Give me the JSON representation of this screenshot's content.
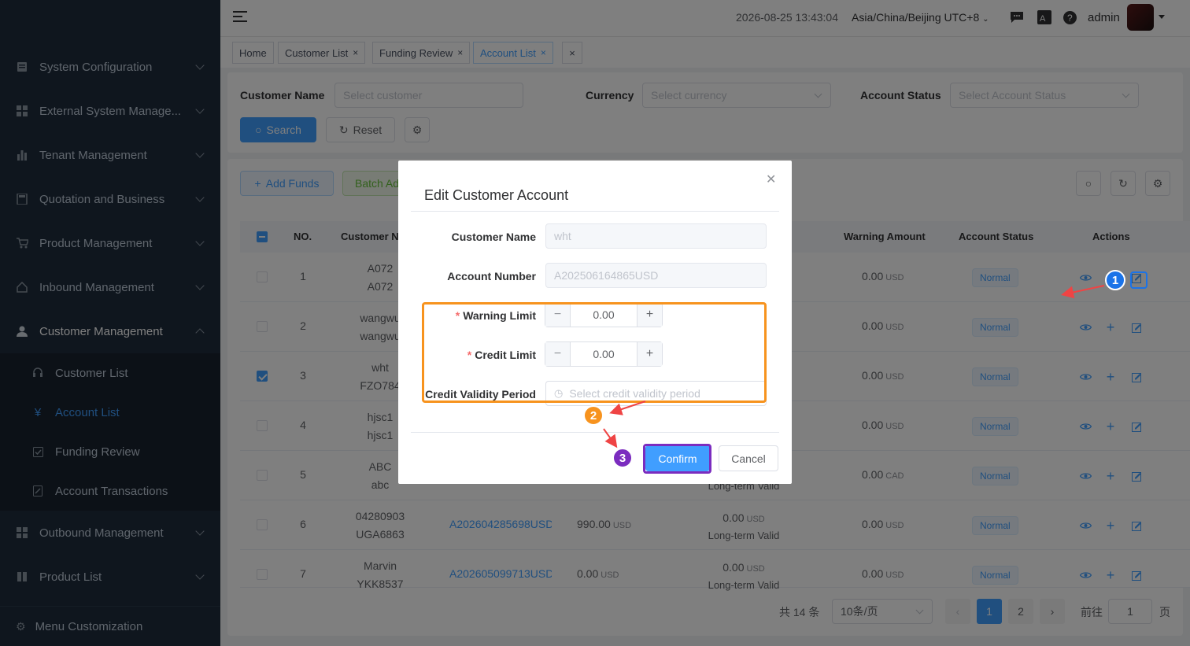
{
  "header": {
    "datetime": "2026-08-25 13:43:04",
    "timezone": "Asia/China/Beijing UTC+8",
    "user": "admin"
  },
  "sidebar": {
    "items": [
      {
        "label": "System Configuration"
      },
      {
        "label": "External System Manage..."
      },
      {
        "label": "Tenant Management"
      },
      {
        "label": "Quotation and Business"
      },
      {
        "label": "Product Management"
      },
      {
        "label": "Inbound Management"
      },
      {
        "label": "Customer Management"
      },
      {
        "label": "Outbound Management"
      },
      {
        "label": "Product List"
      }
    ],
    "sub_items": [
      {
        "label": "Customer List"
      },
      {
        "label": "Account List"
      },
      {
        "label": "Funding Review"
      },
      {
        "label": "Account Transactions"
      }
    ],
    "footer": "Menu Customization"
  },
  "tags": {
    "items": [
      "Home",
      "Customer List",
      "Funding Review",
      "Account List"
    ],
    "close": "×"
  },
  "search": {
    "customer_name_label": "Customer Name",
    "customer_name_placeholder": "Select customer",
    "currency_label": "Currency",
    "currency_placeholder": "Select currency",
    "status_label": "Account Status",
    "status_placeholder": "Select Account Status",
    "search_btn": "Search",
    "reset_btn": "Reset"
  },
  "toolbar": {
    "add_funds": "Add Funds",
    "batch_add": "Batch Ad"
  },
  "table": {
    "headers": {
      "no": "NO.",
      "customer": "Customer N",
      "warning": "Warning Amount",
      "status": "Account Status",
      "actions": "Actions"
    },
    "rows": [
      {
        "no": "1",
        "name1": "A072",
        "name2": "A072",
        "account": "",
        "balance": "",
        "credit": "",
        "credit_note": "",
        "warning": "0.00",
        "currency": "USD",
        "status": "Normal"
      },
      {
        "no": "2",
        "name1": "wangwu",
        "name2": "wangwu",
        "account": "",
        "balance": "",
        "credit": "",
        "credit_note": "",
        "warning": "0.00",
        "currency": "USD",
        "status": "Normal"
      },
      {
        "no": "3",
        "name1": "wht",
        "name2": "FZO784",
        "account": "",
        "balance": "",
        "credit": "",
        "credit_note": "",
        "warning": "0.00",
        "currency": "USD",
        "status": "Normal"
      },
      {
        "no": "4",
        "name1": "hjsc1",
        "name2": "hjsc1",
        "account": "",
        "balance": "",
        "credit": "",
        "credit_note": "",
        "warning": "0.00",
        "currency": "USD",
        "status": "Normal"
      },
      {
        "no": "5",
        "name1": "ABC",
        "name2": "abc",
        "account": "",
        "balance": "",
        "credit": "",
        "credit_note": "Long-term Valid",
        "warning": "0.00",
        "currency": "CAD",
        "status": "Normal"
      },
      {
        "no": "6",
        "name1": "04280903",
        "name2": "UGA6863",
        "account": "A202604285698USD",
        "balance": "990.00",
        "balance_cur": "USD",
        "credit": "0.00",
        "credit_cur": "USD",
        "credit_note": "Long-term Valid",
        "warning": "0.00",
        "currency": "USD",
        "status": "Normal"
      },
      {
        "no": "7",
        "name1": "Marvin",
        "name2": "YKK8537",
        "account": "A202605099713USD",
        "balance": "0.00",
        "balance_cur": "USD",
        "credit": "0.00",
        "credit_cur": "USD",
        "credit_note": "Long-term Valid",
        "warning": "0.00",
        "currency": "USD",
        "status": "Normal"
      }
    ]
  },
  "pagination": {
    "total": "共 14 条",
    "page_size": "10条/页",
    "pages": [
      "1",
      "2"
    ],
    "goto_label": "前往",
    "goto_value": "1",
    "goto_suffix": "页"
  },
  "dialog": {
    "title": "Edit Customer Account",
    "customer_name_label": "Customer Name",
    "customer_name_value": "wht",
    "account_number_label": "Account Number",
    "account_number_value": "A202506164865USD",
    "warning_limit_label": "Warning Limit",
    "warning_limit_value": "0.00",
    "credit_limit_label": "Credit Limit",
    "credit_limit_value": "0.00",
    "validity_label": "Credit Validity Period",
    "validity_placeholder": "Select credit validity period",
    "confirm": "Confirm",
    "cancel": "Cancel"
  },
  "annotations": {
    "badges": [
      "1",
      "2",
      "3"
    ],
    "colors": {
      "badge1": "#1a73e8",
      "badge2": "#f7931e",
      "badge3": "#7b2cbf",
      "arrow": "#ef4444",
      "highlight": "#f7931e"
    }
  }
}
